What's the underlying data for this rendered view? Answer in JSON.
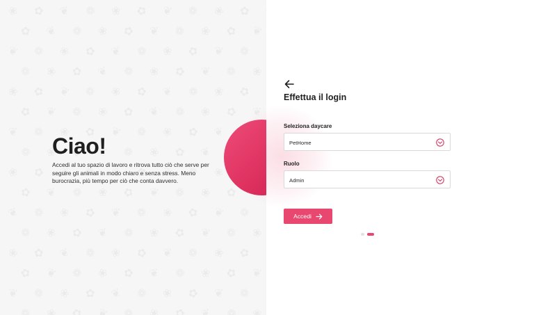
{
  "left": {
    "greeting": "Ciao!",
    "intro": "Accedi al tuo spazio di lavoro e ritrova tutto ciò che serve per seguire gli animali in modo chiaro e senza stress. Meno burocrazia, più tempo per ciò che conta davvero.",
    "pattern_icon": "paw-print-icon"
  },
  "login": {
    "back_icon": "arrow-left-icon",
    "title": "Effettua il login",
    "daycare_label": "Seleziona daycare",
    "daycare_value": "PetHome",
    "role_label": "Ruolo",
    "role_value": "Admin",
    "dropdown_icon": "chevron-down-circle-icon",
    "submit_label": "Accedi",
    "submit_icon": "arrow-right-icon"
  },
  "steps": {
    "total": 2,
    "active": 2
  },
  "colors": {
    "accent": "#e8476f",
    "accent_dark": "#d21f4f",
    "left_background": "#f6f6f6",
    "dot_inactive": "#e2e2e2"
  }
}
